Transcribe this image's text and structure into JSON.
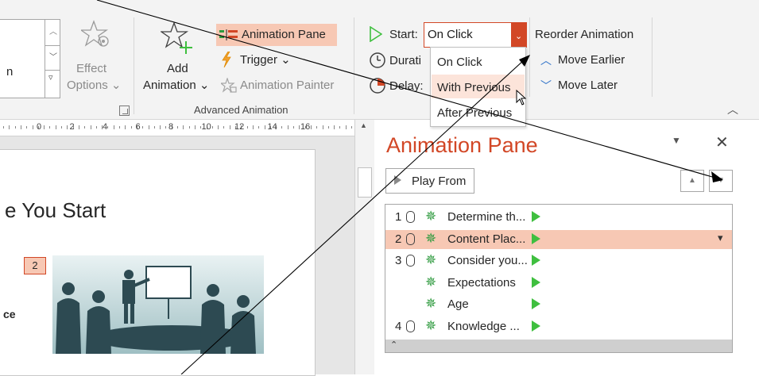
{
  "ribbon": {
    "effect_options": {
      "line1": "Effect",
      "line2": "Options",
      "chevron": "⌄"
    },
    "add_animation": {
      "line1": "Add",
      "line2": "Animation",
      "chevron": "⌄"
    },
    "animation_pane_btn": "Animation Pane",
    "trigger_btn": "Trigger",
    "trigger_chevron": "⌄",
    "animation_painter_btn": "Animation Painter",
    "group_label": "Advanced Animation",
    "left_cut_text": "n",
    "start_label": "Start:",
    "start_value": "On Click",
    "duration_label": "Durati",
    "delay_label": "Delay:",
    "start_options": [
      "On Click",
      "With Previous",
      "After Previous"
    ],
    "reorder_title": "Reorder Animation",
    "move_earlier": "Move Earlier",
    "move_later": "Move Later"
  },
  "ruler": {
    "labels": [
      "0",
      "2",
      "4",
      "6",
      "8",
      "10",
      "12",
      "14",
      "16"
    ]
  },
  "slide": {
    "title_fragment": "e You Start",
    "badge": "2",
    "left_text_fragment": "ce"
  },
  "animation_pane": {
    "title": "Animation Pane",
    "play_from": "Play From",
    "items": [
      {
        "num": "1",
        "label": "Determine th...",
        "has_mouse": true
      },
      {
        "num": "2",
        "label": "Content Plac...",
        "has_mouse": true
      },
      {
        "num": "3",
        "label": "Consider you...",
        "has_mouse": true
      },
      {
        "num": "",
        "label": "Expectations",
        "has_mouse": false
      },
      {
        "num": "",
        "label": "Age",
        "has_mouse": false
      },
      {
        "num": "4",
        "label": "Knowledge ...",
        "has_mouse": true
      }
    ]
  },
  "colors": {
    "accent_orange": "#d24726",
    "highlight": "#f7c8b4",
    "anim_green": "#3fbf3f",
    "link_blue": "#2b6fc7"
  },
  "icons": [
    "star-icon",
    "add-star-icon",
    "animation-pane-icon",
    "lightning-icon",
    "painter-icon",
    "play-icon",
    "clock-icon",
    "delay-icon",
    "chevron-up-icon",
    "chevron-down-icon",
    "close-icon",
    "mouse-icon",
    "effect-star-icon",
    "green-triangle-icon",
    "collapse-icon"
  ]
}
